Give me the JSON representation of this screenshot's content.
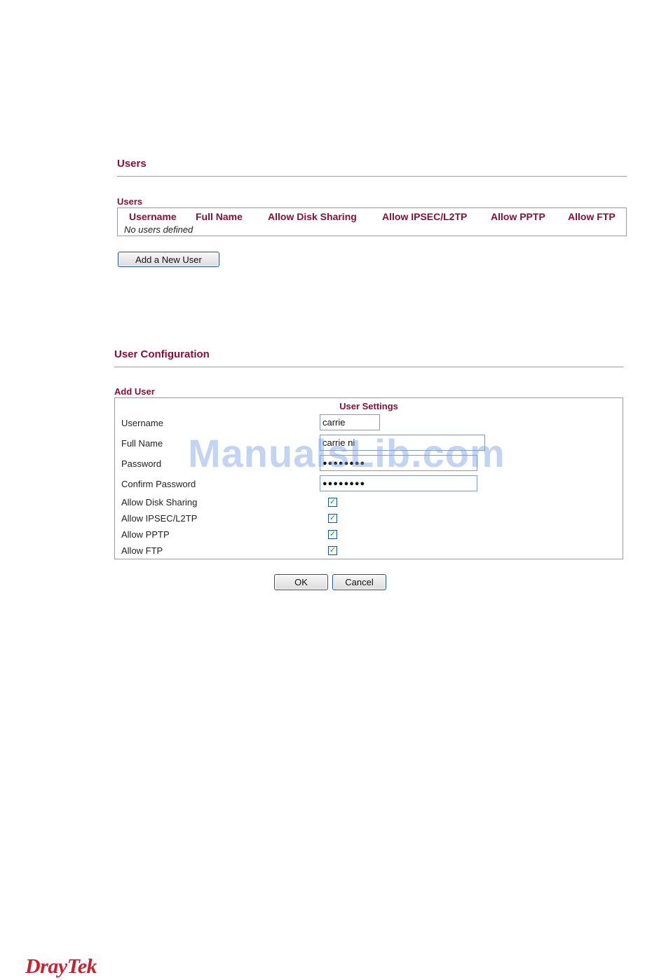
{
  "users_section": {
    "title": "Users",
    "group_label": "Users",
    "columns": [
      "Username",
      "Full Name",
      "Allow Disk Sharing",
      "Allow IPSEC/L2TP",
      "Allow PPTP",
      "Allow FTP"
    ],
    "empty_message": "No users defined",
    "add_button_label": "Add a New User"
  },
  "user_config": {
    "title": "User Configuration",
    "group_label": "Add User",
    "table_title": "User Settings",
    "fields": {
      "username": {
        "label": "Username",
        "value": "carrie"
      },
      "full_name": {
        "label": "Full Name",
        "value": "carrie ni"
      },
      "password": {
        "label": "Password",
        "value": "●●●●●●●●"
      },
      "confirm_password": {
        "label": "Confirm Password",
        "value": "●●●●●●●●"
      }
    },
    "checkboxes": [
      {
        "label": "Allow Disk Sharing",
        "checked": true
      },
      {
        "label": "Allow IPSEC/L2TP",
        "checked": true
      },
      {
        "label": "Allow PPTP",
        "checked": true
      },
      {
        "label": "Allow FTP",
        "checked": true
      }
    ],
    "ok_label": "OK",
    "cancel_label": "Cancel"
  },
  "watermark": "ManualsLib.com",
  "logo": "DrayTek",
  "colors": {
    "accent": "#8b0d3a",
    "check": "#21a121",
    "logo": "#cc1f2e",
    "button_border": "#1e4f8a"
  }
}
